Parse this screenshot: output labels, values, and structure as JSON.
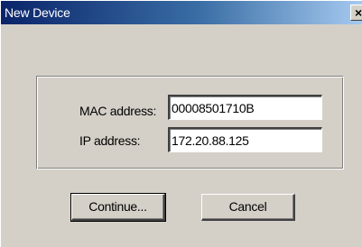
{
  "window": {
    "title": "New Device",
    "close_glyph": "×"
  },
  "form": {
    "mac_label": "MAC address:",
    "mac_value": "00008501710B",
    "ip_label": "IP address:",
    "ip_value": "172.20.88.125"
  },
  "buttons": {
    "continue_label": "Continue...",
    "cancel_label": "Cancel"
  },
  "colors": {
    "titlebar_start": "#0a246a",
    "titlebar_end": "#a6caf0",
    "dialog_face": "#d4d0c8"
  }
}
